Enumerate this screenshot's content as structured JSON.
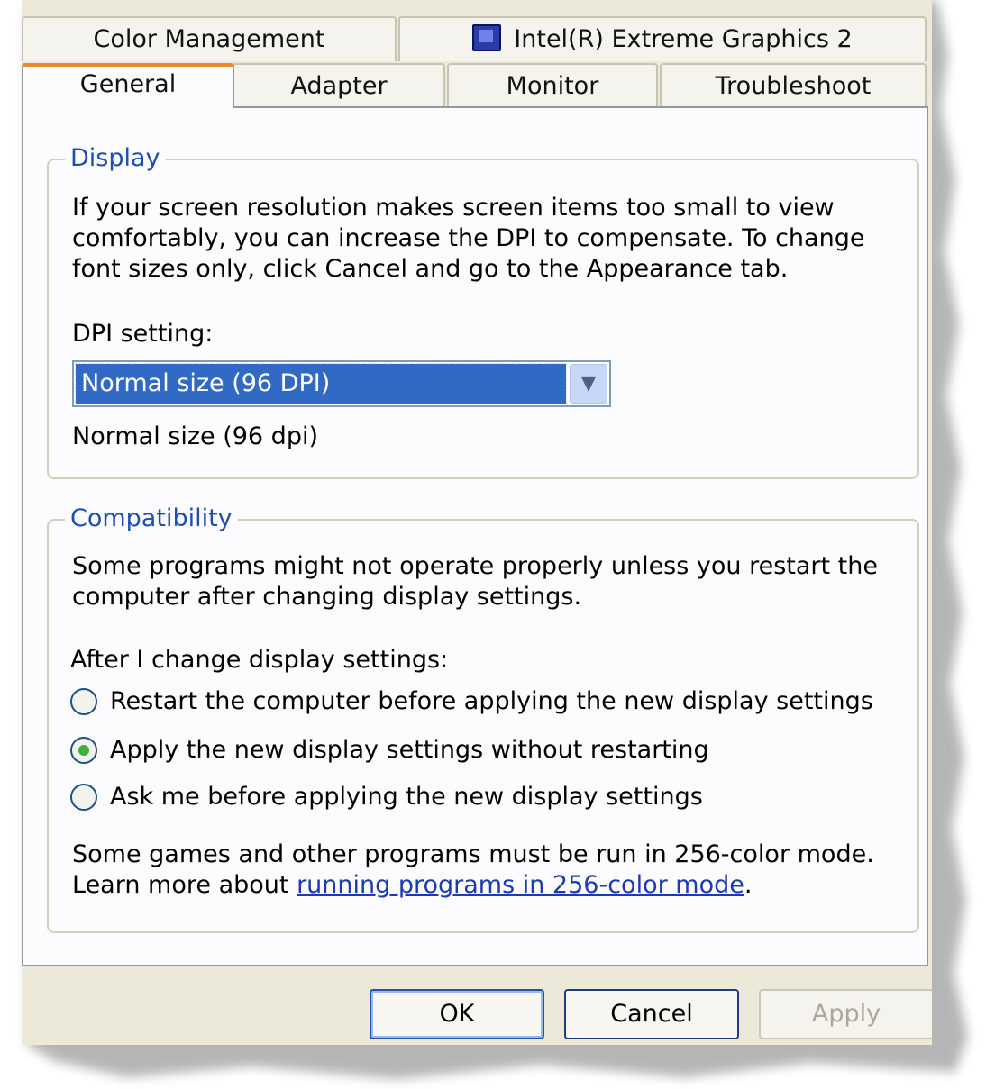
{
  "tabs_top": [
    {
      "label": "Color Management"
    },
    {
      "label": "Intel(R) Extreme Graphics 2",
      "icon": "intel-graphics-icon"
    }
  ],
  "tabs_bottom": [
    {
      "label": "General",
      "active": true
    },
    {
      "label": "Adapter"
    },
    {
      "label": "Monitor"
    },
    {
      "label": "Troubleshoot"
    }
  ],
  "display": {
    "legend": "Display",
    "description_lines": [
      "If your screen resolution makes screen items too small to view",
      "comfortably, you can increase the DPI to compensate.  To change",
      "font sizes only, click Cancel and go to the Appearance tab."
    ],
    "dpi_label": "DPI setting:",
    "dpi_selected": "Normal size (96 DPI)",
    "dpi_note": "Normal size (96 dpi)"
  },
  "compatibility": {
    "legend": "Compatibility",
    "description_lines": [
      "Some programs might not operate properly unless you restart the",
      "computer after changing display settings."
    ],
    "after_label": "After I change display settings:",
    "options": [
      {
        "label": "Restart the computer before applying the new display settings",
        "checked": false
      },
      {
        "label": "Apply the new display settings without restarting",
        "checked": true
      },
      {
        "label": "Ask me before applying the new display settings",
        "checked": false
      }
    ],
    "games_line": "Some games and other programs must be run in 256-color mode.",
    "learn_prefix": "Learn more about ",
    "learn_link": "running programs in 256-color mode",
    "learn_suffix": "."
  },
  "buttons": {
    "ok": "OK",
    "cancel": "Cancel",
    "apply": "Apply"
  },
  "colors": {
    "dialog_bg": "#ece9d8",
    "accent_tab": "#e68b2c",
    "group_legend": "#1f4fae",
    "selection": "#316ac5"
  }
}
